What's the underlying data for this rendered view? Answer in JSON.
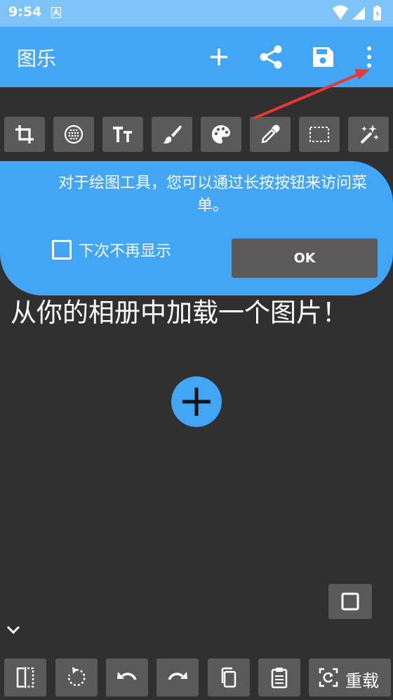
{
  "status_bar": {
    "time": "9:54"
  },
  "app_bar": {
    "title": "图乐"
  },
  "tooltip": {
    "message": "对于绘图工具，您可以通过长按按钮来访问菜单。",
    "checkbox_label": "下次不再显示",
    "ok_label": "OK"
  },
  "main": {
    "load_message": "从你的相册中加载一个图片！"
  },
  "bottom_bar": {
    "reload_label": "重载"
  },
  "colors": {
    "accent": "#42a5f5",
    "background": "#303030",
    "button": "#5a5a5a",
    "status_bar": "#7ec3f7",
    "arrow": "#e53935"
  }
}
